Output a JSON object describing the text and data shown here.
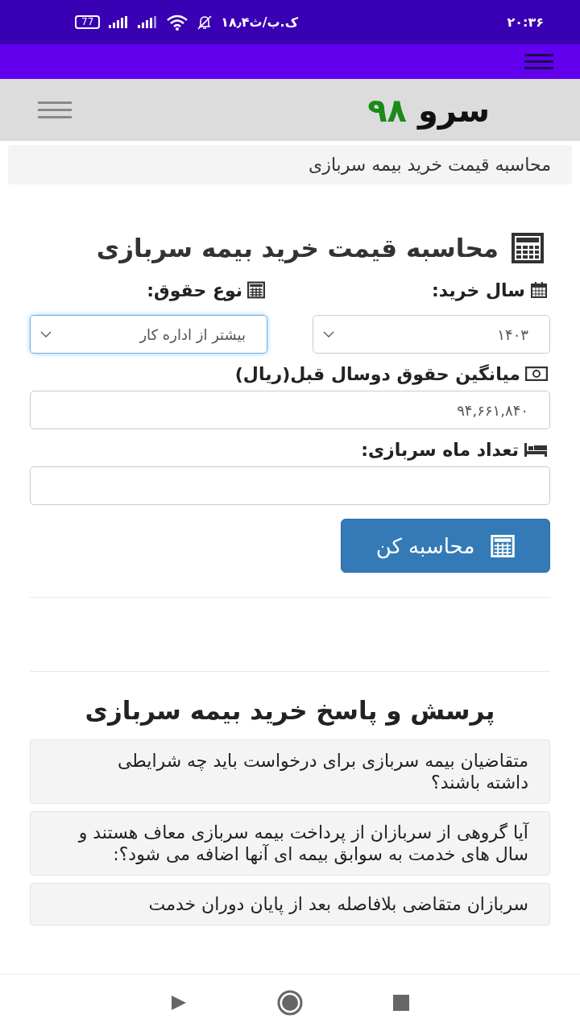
{
  "status_bar": {
    "time": "۲۰:۳۶",
    "net_speed": "۱۸٫۴ک.ب/ث",
    "battery": "77"
  },
  "logo": {
    "name": "سرو",
    "number": "۹۸"
  },
  "breadcrumb": "محاسبه قیمت خرید بیمه سربازی",
  "calculator": {
    "title": "محاسبه قیمت خرید بیمه سربازی",
    "fields": [
      {
        "kind": "select",
        "label": "سال خرید:",
        "value": "۱۴۰۳",
        "focused": false
      },
      {
        "kind": "select",
        "label": "نوع حقوق:",
        "value": "بیشتر از اداره کار",
        "focused": true
      },
      {
        "kind": "input",
        "label": "میانگین حقوق دوسال قبل(ریال)",
        "value": "۹۴,۶۶۱,۸۴۰",
        "focused": false
      },
      {
        "kind": "input",
        "label": "تعداد ماه سربازی:",
        "focused": false
      }
    ],
    "button": "محاسبه کن"
  },
  "faq": {
    "title": "پرسش و پاسخ خرید بیمه سربازی",
    "questions": [
      "متقاضیان بیمه سربازی برای درخواست باید چه شرایطی داشته باشند؟",
      "آیا گروهی از سربازان از پرداخت بیمه سربازی معاف هستند و سال های خدمت به سوابق بیمه ای آنها اضافه می شود؟:",
      "سربازان متقاضی بلافاصله بعد از پایان دوران خدمت"
    ]
  }
}
